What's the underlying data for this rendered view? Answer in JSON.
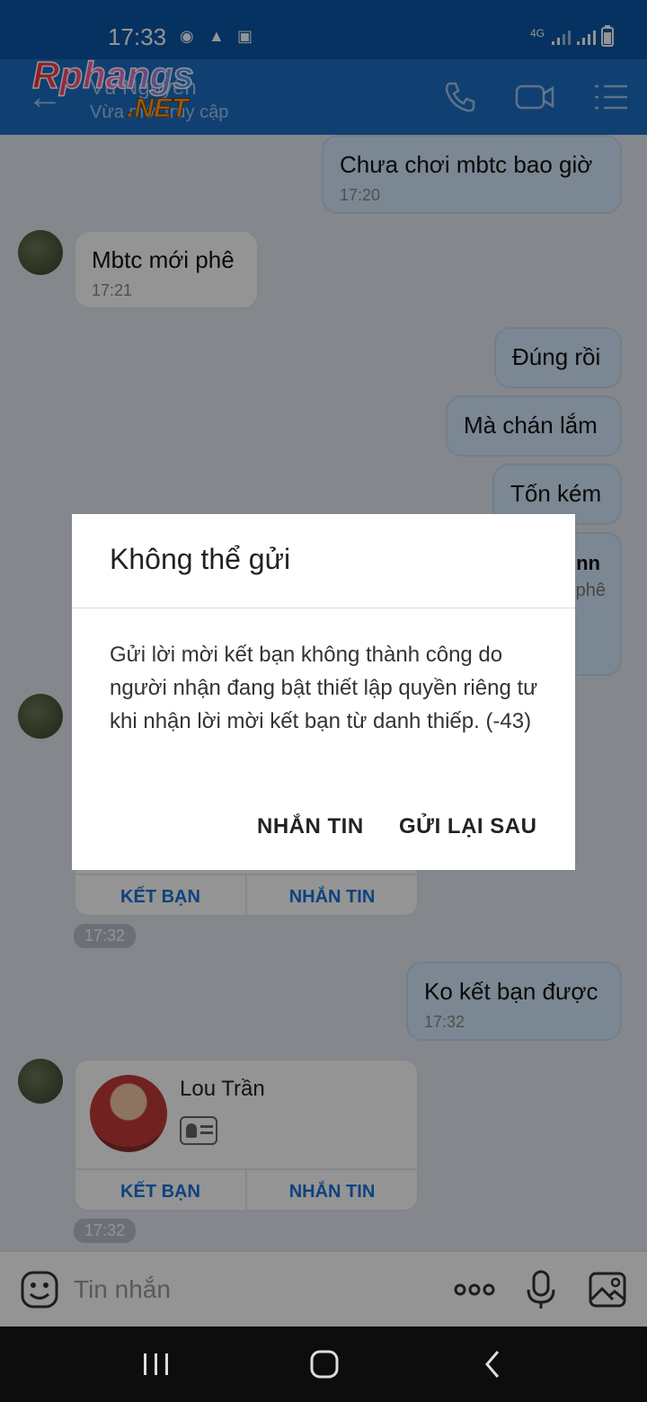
{
  "status_bar": {
    "time": "17:33",
    "network": "4G"
  },
  "header": {
    "contact_name": "Vũ Nguyễn",
    "contact_status": "Vừa mới truy cập",
    "watermark_logo": "Rphangs.NET",
    "icons": [
      "back-arrow-icon",
      "phone-icon",
      "video-call-icon",
      "menu-list-icon"
    ]
  },
  "chat": {
    "messages": [
      {
        "dir": "out",
        "text": "Chưa chơi mbtc bao giờ",
        "time": "17:20"
      },
      {
        "dir": "in",
        "text": "Mbtc mới phê",
        "time": "17:21"
      },
      {
        "dir": "out",
        "text": "Đúng rồi"
      },
      {
        "dir": "out",
        "text": "Mà chán lắm"
      },
      {
        "dir": "out",
        "text": "Tốn kém"
      },
      {
        "dir": "out",
        "text": "Ko kết bạn được",
        "time": "17:32"
      }
    ],
    "partial_card": {
      "name_fragment": "nn",
      "text_fragment": "phê"
    },
    "cards": [
      {
        "name": "",
        "add_friend_label": "KẾT BẠN",
        "message_label": "NHẮN TIN",
        "time": "17:32"
      },
      {
        "name": "Lou Trần",
        "add_friend_label": "KẾT BẠN",
        "message_label": "NHẮN TIN",
        "time": "17:32"
      }
    ]
  },
  "input_bar": {
    "placeholder": "Tin nhắn",
    "icons": [
      "emoji-icon",
      "more-icon",
      "microphone-icon",
      "image-icon"
    ]
  },
  "dialog": {
    "title": "Không thể gửi",
    "message": "Gửi lời mời kết bạn không thành công do người nhận đang bật thiết lập quyền riêng tư khi nhận lời mời kết bạn từ danh thiếp. (-43)",
    "button_message": "NHẮN TIN",
    "button_later": "GỬI LẠI SAU"
  },
  "colors": {
    "accent": "#1a73d9",
    "header": "#1c6fc4",
    "outgoing_bubble": "#d5e9fb"
  }
}
